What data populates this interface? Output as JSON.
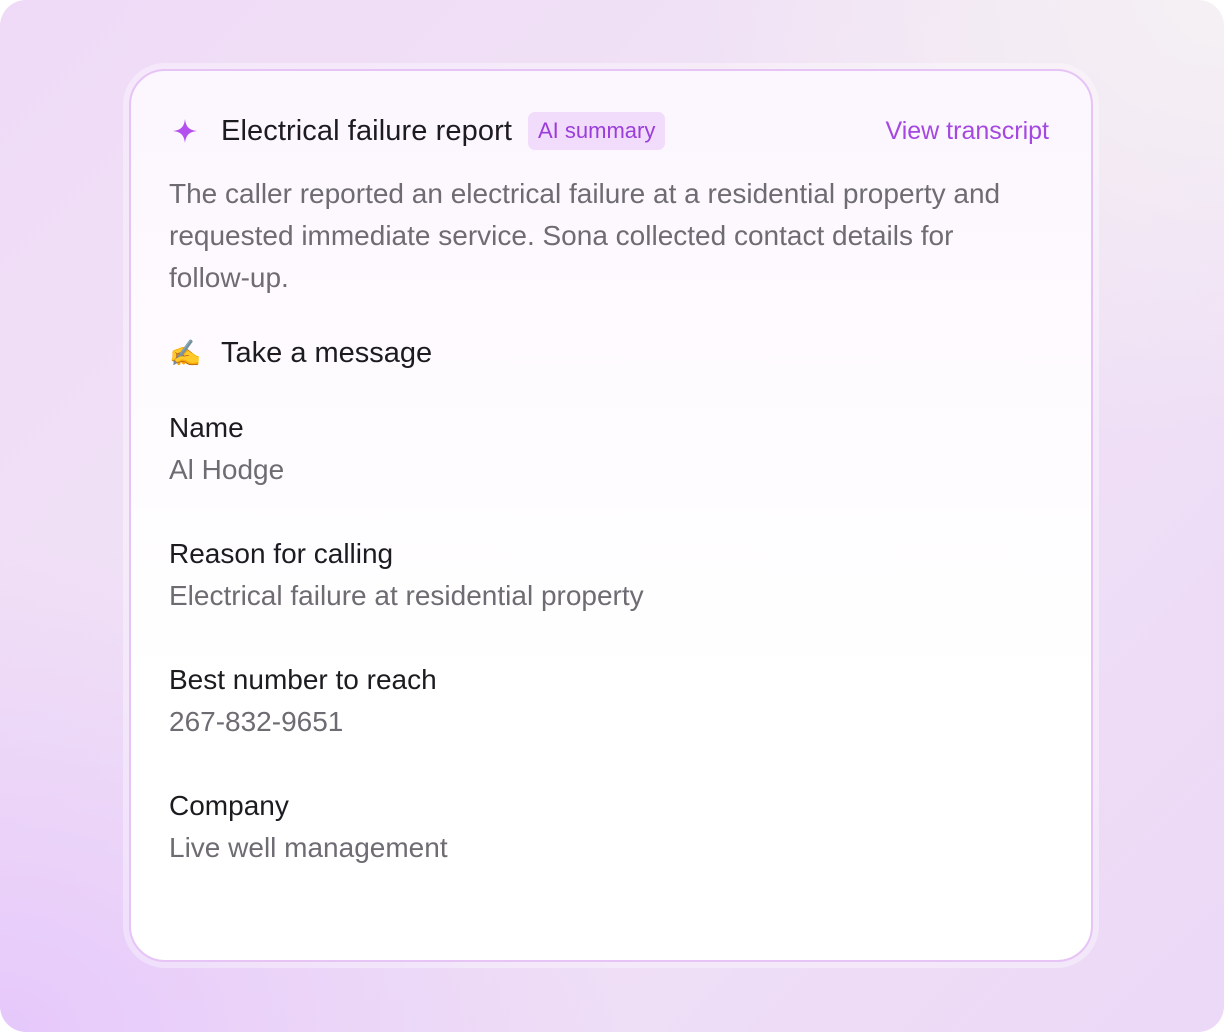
{
  "report": {
    "title": "Electrical failure report",
    "badge": "AI summary",
    "transcript_link": "View transcript",
    "summary": "The caller reported an electrical failure at a residential property and requested immediate service. Sona collected contact details for follow-up."
  },
  "section": {
    "emoji": "✍️",
    "title": "Take a message"
  },
  "fields": [
    {
      "label": "Name",
      "value": "Al Hodge"
    },
    {
      "label": "Reason for calling",
      "value": "Electrical failure at residential property"
    },
    {
      "label": "Best number to reach",
      "value": "267-832-9651"
    },
    {
      "label": "Company",
      "value": "Live well management"
    }
  ],
  "colors": {
    "accent": "#a448e0",
    "badge_bg": "#f1dcfb",
    "sparkle": "#b44ff0",
    "card_border": "#e7c4f6"
  },
  "icons": {
    "header": "sparkle-icon",
    "section": "writing-hand-icon"
  }
}
